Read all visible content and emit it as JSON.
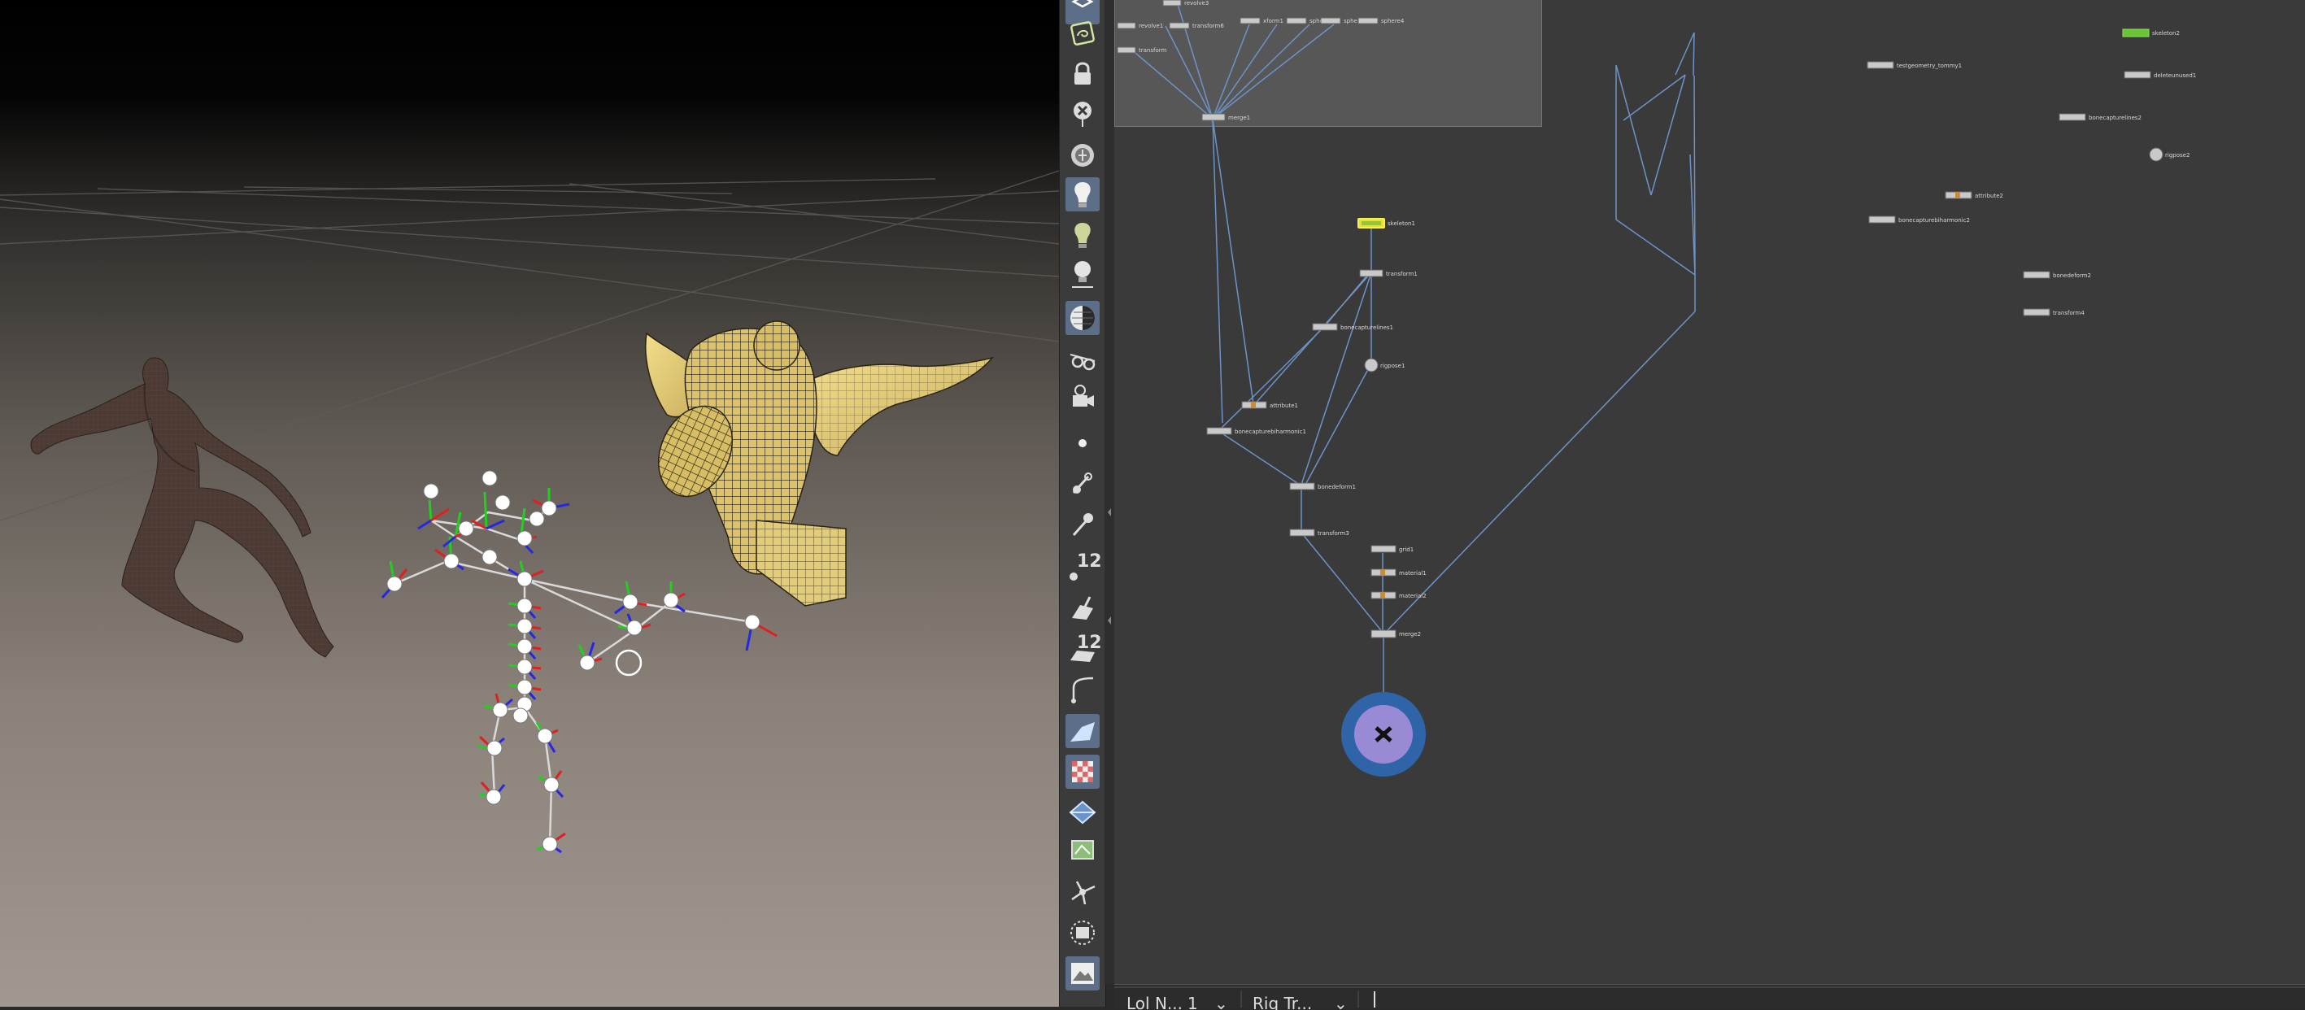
{
  "viewport": {
    "handle_count_badge": "12",
    "handle_count_badge_2": "12"
  },
  "toolbar": {
    "tools": [
      "select-tool",
      "view-tool",
      "lock-tool",
      "close-tool",
      "ghost-tool",
      "light-tool",
      "lightbulb-tool",
      "headlight-tool",
      "point-light-tool",
      "shading-tool",
      "visibility-tool",
      "camera-tool",
      "point-tool",
      "edge-tool",
      "pin-tool",
      "vertex-count-tool",
      "paint-tool",
      "face-count-tool",
      "curve-tool",
      "draw-tool",
      "checker-tool",
      "ortho-tool",
      "display-tool",
      "snap-tool",
      "isolate-tool",
      "background-image-tool"
    ]
  },
  "network": {
    "nodes": {
      "n_top_a": "revolve3",
      "n_top_b": "revolve1",
      "n_top_c": "transform6",
      "n_top_d": "xform1",
      "n_top_e": "sphere2",
      "n_top_f": "sphere1",
      "n_top_g": "sphere4",
      "n_top_h": "transform",
      "merge1": "merge1",
      "skeleton1": "skeleton1",
      "transform1": "transform1",
      "bonecapturelines1": "bonecapturelines1",
      "rigpose1": "rigpose1",
      "attribute1": "attribute1",
      "bonecapturebiharmonic1": "bonecapturebiharmonic1",
      "bonedeform1": "bonedeform1",
      "transform3": "transform3",
      "grid1": "grid1",
      "material1": "material1",
      "material2": "material2",
      "merge2": "merge2",
      "skeleton2": "skeleton2",
      "testgeometry_tommy1": "testgeometry_tommy1",
      "deleteunused1": "deleteunused1",
      "bonecapturelines2": "bonecapturelines2",
      "attribute2": "attribute2",
      "rigpose2": "rigpose2",
      "bonecapturebiharmonic2": "bonecapturebiharmonic2",
      "bonedeform2": "bonedeform2",
      "transform4": "transform4"
    }
  },
  "statusbar": {
    "tab1_label": "Lol N...",
    "tab1_value": "1",
    "tab2_label": "Rig Tr..."
  }
}
